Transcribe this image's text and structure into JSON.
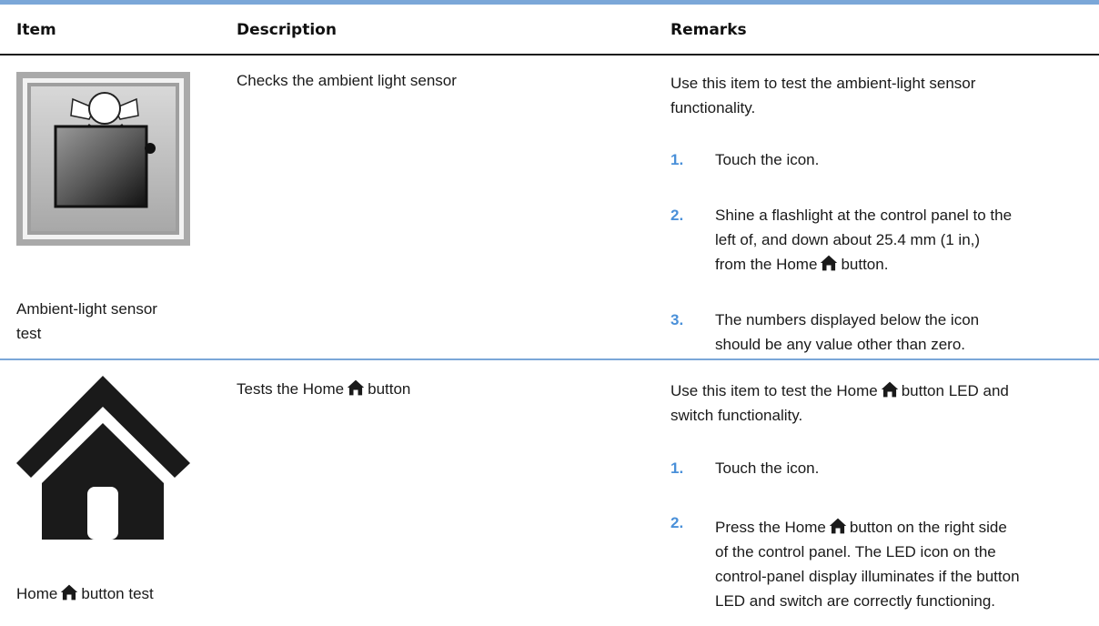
{
  "headers": {
    "item": "Item",
    "description": "Description",
    "remarks": "Remarks"
  },
  "colors": {
    "accent_rule": "#7ba7d8",
    "step_number": "#4a90d9",
    "text": "#1a1a1a"
  },
  "rows": [
    {
      "item_icon": "ambient-light-sensor-icon",
      "item_label_line1": "Ambient-light sensor",
      "item_label_line2": "test",
      "description": "Checks the ambient light sensor",
      "intro_line1": "Use this item to test the ambient-light sensor",
      "intro_line2": "functionality.",
      "steps": [
        {
          "num": "1.",
          "lines": [
            "Touch the icon."
          ]
        },
        {
          "num": "2.",
          "lines": [
            "Shine a flashlight at the control panel to the",
            "left of, and down about 25.4 mm (1 in,)",
            "from the Home",
            "button."
          ]
        },
        {
          "num": "3.",
          "lines": [
            "The numbers displayed below the icon",
            "should be any value other than zero."
          ]
        }
      ]
    },
    {
      "item_icon": "home-icon",
      "item_label_a": "Home",
      "item_label_b": "button test",
      "description_a": "Tests the Home",
      "description_b": "button",
      "intro_a": "Use this item to test the Home",
      "intro_b": "button LED and",
      "intro_line2": "switch functionality.",
      "steps": [
        {
          "num": "1.",
          "lines": [
            "Touch the icon."
          ]
        },
        {
          "num": "2.",
          "lines": [
            "Press the Home",
            "button on the right side",
            "of the control panel. The LED icon on the",
            "control-panel display illuminates if the button",
            "LED and switch are correctly functioning."
          ]
        }
      ]
    }
  ]
}
